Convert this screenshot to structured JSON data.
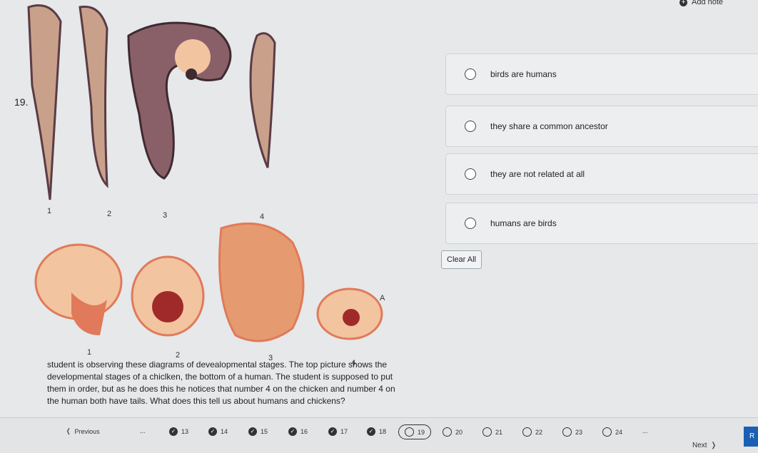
{
  "header": {
    "add_note": "Add note"
  },
  "question": {
    "number": "19.",
    "top_labels": [
      "1",
      "2",
      "3",
      "4"
    ],
    "bottom_labels": [
      "1",
      "2",
      "3",
      "4"
    ],
    "tail_label": "A",
    "text": "student is observing these diagrams of devealopmental stages. The top picture shows the developmental stages of a chiclken, the bottom of a human. The student is supposed to put them in order, but as he does this he notices that number 4 on the chicken and number 4 on the human both have tails. What does this tell us about humans and chickens?"
  },
  "options": [
    {
      "label": "birds are humans",
      "selected": false
    },
    {
      "label": "they share a common ancestor",
      "selected": false
    },
    {
      "label": "they are not related at all",
      "selected": false
    },
    {
      "label": "humans are birds",
      "selected": false
    }
  ],
  "clear_all": "Clear All",
  "nav": {
    "previous": "Previous",
    "next": "Next",
    "review": "R",
    "ellipsis": "...",
    "answered": [
      "13",
      "14",
      "15",
      "16",
      "17",
      "18"
    ],
    "current": "19",
    "unanswered": [
      "20",
      "21",
      "22",
      "23",
      "24"
    ]
  },
  "colors": {
    "embryo_light": "#f2c4a0",
    "embryo_mid": "#e07a5a",
    "embryo_dark": "#6b4a55",
    "accent": "#1a5fb4"
  }
}
